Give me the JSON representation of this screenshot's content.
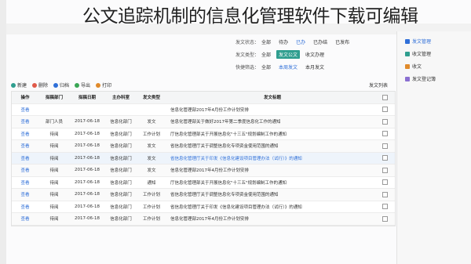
{
  "caption": "公文追踪机制的信息化管理软件下载可编辑",
  "sidebar": {
    "items": [
      {
        "label": "发文管理",
        "icon": "document-icon",
        "color": "#2f6fd8",
        "active": true
      },
      {
        "label": "收文管理",
        "icon": "inbox-icon",
        "color": "#2f9e8f",
        "active": false
      },
      {
        "label": "收文",
        "icon": "mail-icon",
        "color": "#e08a2b",
        "active": false
      },
      {
        "label": "发文登记簿",
        "icon": "book-icon",
        "color": "#8a6fd1",
        "active": false
      }
    ]
  },
  "filters": {
    "row1": {
      "label": "发文状态：",
      "options": [
        "全部",
        "待办",
        "已办",
        "已办结",
        "已发布"
      ]
    },
    "row2": {
      "label": "发文类型：",
      "options": [
        "全部",
        "发文公文",
        "收文办理"
      ]
    },
    "row3": {
      "label": "快捷筛选：",
      "options": [
        "全部",
        "本周发文",
        "本月发文"
      ]
    }
  },
  "toolbar": {
    "buttons": [
      {
        "label": "新建",
        "color": "#2f9e8f"
      },
      {
        "label": "删除",
        "color": "#e05a4a"
      },
      {
        "label": "归档",
        "color": "#2f6fd8"
      },
      {
        "label": "导出",
        "color": "#3aa655"
      },
      {
        "label": "打印",
        "color": "#e08a2b"
      }
    ],
    "panel_title": "发文列表"
  },
  "table": {
    "headers": {
      "op": "操作",
      "dept": "拟稿部门",
      "date": "拟稿日期",
      "org": "主办科室",
      "type": "发文类型",
      "title": "发文标题"
    },
    "rows": [
      {
        "op": "查看",
        "dept": "",
        "date": "",
        "org": "",
        "type": "",
        "title": "信息化管理部2017年4月份工作计划安排",
        "hl": false
      },
      {
        "op": "查看",
        "dept": "部门人员",
        "date": "2017-06-18",
        "org": "信息化部门",
        "type": "发文",
        "title": "信息化管理部关于做好2017年第二季度信息化工作的通知",
        "hl": false
      },
      {
        "op": "查看",
        "dept": "待阅",
        "date": "2017-06-18",
        "org": "信息化部门",
        "type": "工作计划",
        "title": "厅信息化管理部关于开展信息化\"十三五\"规划编制工作的通知",
        "hl": false
      },
      {
        "op": "查看",
        "dept": "待阅",
        "date": "2017-06-18",
        "org": "信息化部门",
        "type": "发文",
        "title": "省信息化管理厅关于调整信息化专项资金使用范围的通知",
        "hl": false
      },
      {
        "op": "查看",
        "dept": "待阅",
        "date": "2017-06-18",
        "org": "信息化部门",
        "type": "发文",
        "title": "省信息化管理厅关于印发《信息化建设项目管理办法（试行）》的通知",
        "hl": true
      },
      {
        "op": "查看",
        "dept": "待阅",
        "date": "2017-06-18",
        "org": "信息化部门",
        "type": "发文",
        "title": "信息化管理部2017年4月份工作计划安排",
        "hl": false
      },
      {
        "op": "查看",
        "dept": "待阅",
        "date": "2017-06-18",
        "org": "信息化部门",
        "type": "通知",
        "title": "厅信息化管理部关于开展信息化\"十三五\"规划编制工作的通知",
        "hl": false
      },
      {
        "op": "查看",
        "dept": "待阅",
        "date": "2017-06-18",
        "org": "信息化部门",
        "type": "工作计划",
        "title": "省信息化管理厅关于调整信息化专项资金使用范围的通知",
        "hl": false
      },
      {
        "op": "查看",
        "dept": "待阅",
        "date": "2017-06-18",
        "org": "信息化部门",
        "type": "工作计划",
        "title": "省信息化管理厅关于印发《信息化建设项目管理办法（试行）》的通知",
        "hl": false
      },
      {
        "op": "查看",
        "dept": "待阅",
        "date": "2017-06-18",
        "org": "信息化部门",
        "type": "工作计划",
        "title": "信息化管理部2017年4月份工作计划安排",
        "hl": false
      }
    ]
  }
}
